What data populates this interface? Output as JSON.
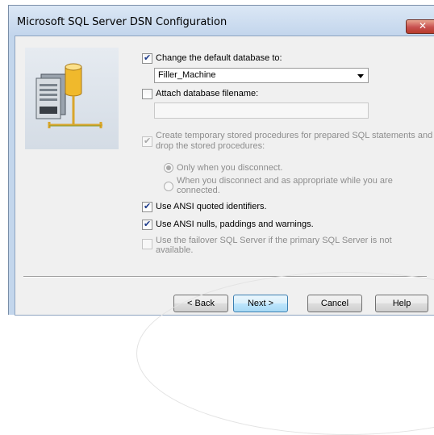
{
  "window": {
    "title": "Microsoft SQL Server DSN Configuration",
    "close_glyph": "✕"
  },
  "options": {
    "change_default_db": {
      "label": "Change the default database to:",
      "checked": true
    },
    "database_value": "Filler_Machine",
    "attach_db": {
      "label": "Attach database filename:",
      "checked": false
    },
    "attach_db_value": "",
    "temp_procs": {
      "line1": "Create temporary stored procedures for prepared SQL statements and",
      "line2": "drop the stored procedures:",
      "checked": true,
      "disabled": true
    },
    "radio_disconnect": {
      "label": "Only when you disconnect.",
      "selected": true
    },
    "radio_appropriate": {
      "line1": "When you disconnect and as appropriate while you are",
      "line2": "connected."
    },
    "ansi_quoted": {
      "label": "Use ANSI quoted identifiers.",
      "checked": true
    },
    "ansi_nulls": {
      "label": "Use ANSI nulls, paddings and warnings.",
      "checked": true
    },
    "failover": {
      "line1": "Use the failover SQL Server if the primary SQL Server is not",
      "line2": "available.",
      "checked": false,
      "disabled": true
    }
  },
  "buttons": {
    "back": "< Back",
    "next": "Next >",
    "cancel": "Cancel",
    "help": "Help"
  },
  "icons": {
    "wizard_art": "database-server-icon",
    "close": "close-icon"
  },
  "colors": {
    "title_bar": "#c2d5ec",
    "close_button": "#c75050",
    "dialog_bg": "#f0f0f0",
    "database_cylinder": "#f2c13a"
  }
}
